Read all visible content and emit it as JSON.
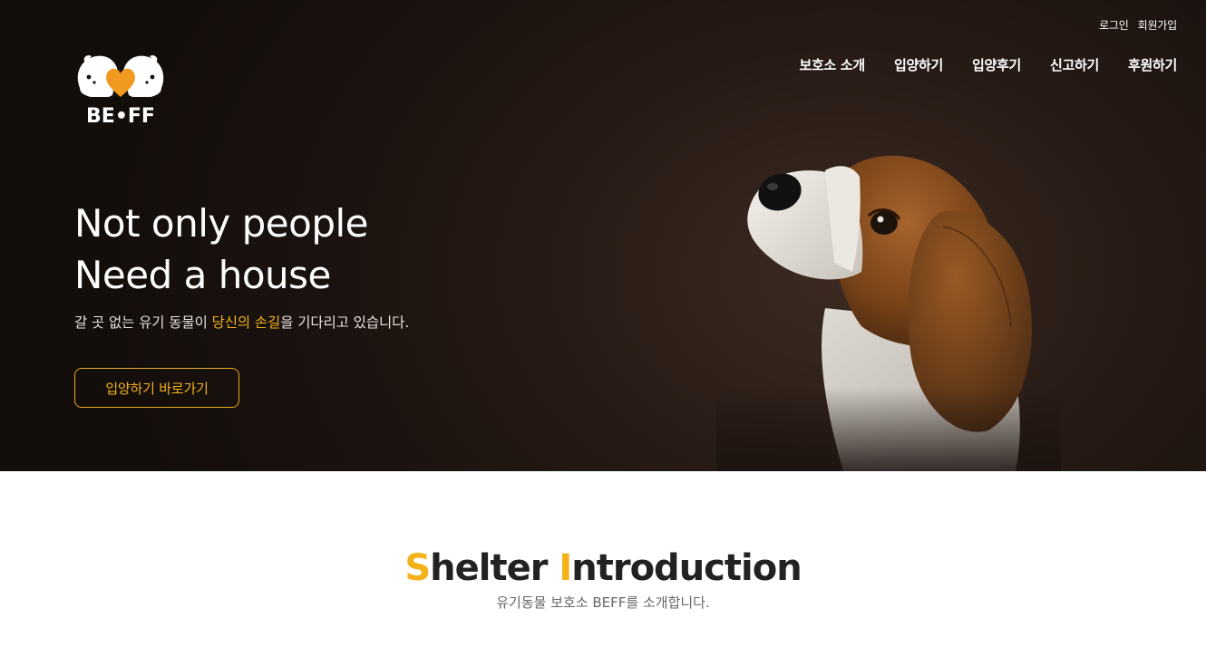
{
  "header": {
    "util_links": [
      "로그인",
      "회원가입"
    ],
    "logo_text": "BE•FF",
    "nav": [
      "보호소 소개",
      "입양하기",
      "입양후기",
      "신고하기",
      "후원하기"
    ]
  },
  "hero": {
    "title_line1": "Not only people",
    "title_line2": "Need a house",
    "sub_before": "갈 곳 없는 유기 동물이 ",
    "sub_highlight": "당신의 손길",
    "sub_after": "을 기다리고 있습니다.",
    "cta_label": "입양하기 바로가기"
  },
  "section": {
    "title_s": "S",
    "title_mid": "helter ",
    "title_i": "I",
    "title_rest": "ntroduction",
    "subtitle": "유기동물 보호소 BEFF를 소개합니다."
  },
  "colors": {
    "accent": "#f3b318",
    "hero_bg": "#1a120f",
    "text_dark": "#222222"
  },
  "icons": {
    "logo": "beff-logo-icon",
    "hero_image": "beagle-dog-image"
  }
}
